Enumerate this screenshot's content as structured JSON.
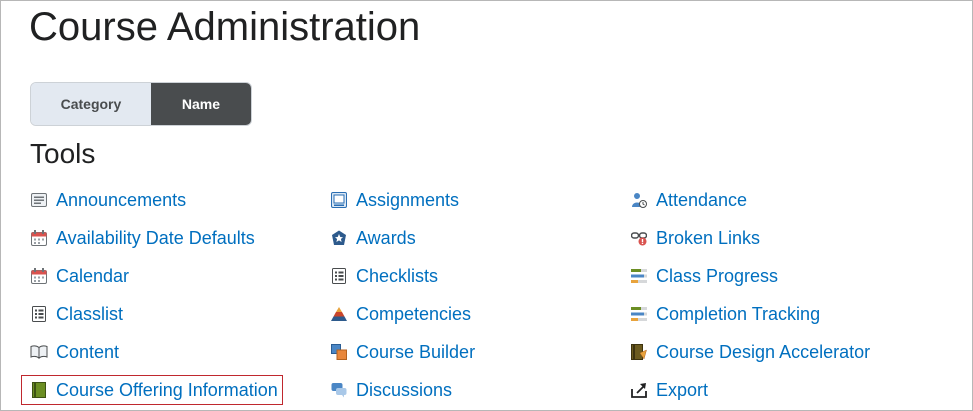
{
  "page": {
    "title": "Course Administration",
    "section_heading": "Tools"
  },
  "toggle": {
    "category_label": "Category",
    "name_label": "Name",
    "selected": "Name"
  },
  "colors": {
    "link": "#006fbf",
    "active_toggle": "#494c4e",
    "inactive_toggle": "#e3e9f1",
    "highlight_border": "#c0282e"
  },
  "tools": {
    "col1": [
      {
        "label": "Announcements",
        "icon": "announcements-icon"
      },
      {
        "label": "Availability Date Defaults",
        "icon": "calendar-icon"
      },
      {
        "label": "Calendar",
        "icon": "calendar-icon"
      },
      {
        "label": "Classlist",
        "icon": "classlist-icon"
      },
      {
        "label": "Content",
        "icon": "book-open-icon"
      },
      {
        "label": "Course Offering Information",
        "icon": "book-icon",
        "highlighted": true
      }
    ],
    "col2": [
      {
        "label": "Assignments",
        "icon": "assignments-icon"
      },
      {
        "label": "Awards",
        "icon": "award-icon"
      },
      {
        "label": "Checklists",
        "icon": "checklist-icon"
      },
      {
        "label": "Competencies",
        "icon": "competencies-icon"
      },
      {
        "label": "Course Builder",
        "icon": "course-builder-icon"
      },
      {
        "label": "Discussions",
        "icon": "discussions-icon"
      }
    ],
    "col3": [
      {
        "label": "Attendance",
        "icon": "attendance-icon"
      },
      {
        "label": "Broken Links",
        "icon": "broken-link-icon"
      },
      {
        "label": "Class Progress",
        "icon": "progress-icon"
      },
      {
        "label": "Completion Tracking",
        "icon": "progress-icon"
      },
      {
        "label": "Course Design Accelerator",
        "icon": "design-accelerator-icon"
      },
      {
        "label": "Export",
        "icon": "export-icon"
      }
    ]
  }
}
